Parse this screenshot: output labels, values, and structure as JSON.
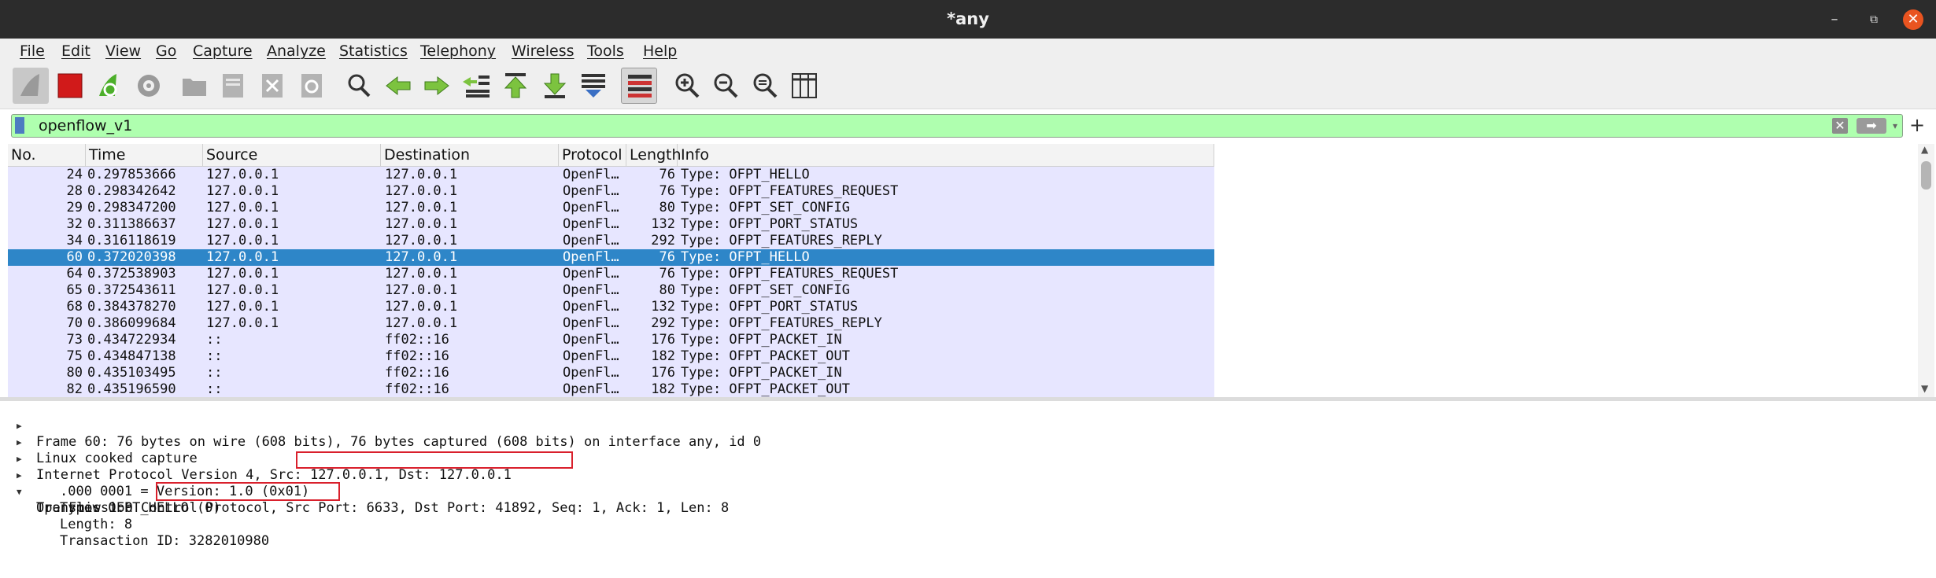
{
  "window": {
    "title": "*any"
  },
  "menu": [
    "File",
    "Edit",
    "View",
    "Go",
    "Capture",
    "Analyze",
    "Statistics",
    "Telephony",
    "Wireless",
    "Tools",
    "Help"
  ],
  "toolbar": {
    "icons": [
      "shark-fin-start-icon",
      "stop-capture-icon",
      "restart-capture-icon",
      "capture-options-icon",
      "open-file-icon",
      "save-file-icon",
      "close-file-icon",
      "reload-file-icon",
      "find-packet-icon",
      "go-back-icon",
      "go-forward-icon",
      "go-to-packet-icon",
      "go-first-icon",
      "go-last-icon",
      "autoscroll-icon",
      "colorize-icon",
      "zoom-in-icon",
      "zoom-out-icon",
      "zoom-normal-icon",
      "resize-columns-icon"
    ]
  },
  "filter": {
    "value": "openflow_v1",
    "plus": "+"
  },
  "packet_list": {
    "columns": [
      "No.",
      "Time",
      "Source",
      "Destination",
      "Protocol",
      "Length",
      "Info"
    ],
    "rows": [
      {
        "no": "24",
        "time": "0.297853666",
        "src": "127.0.0.1",
        "dst": "127.0.0.1",
        "proto": "OpenFl…",
        "len": "76",
        "info": "Type: OFPT_HELLO"
      },
      {
        "no": "28",
        "time": "0.298342642",
        "src": "127.0.0.1",
        "dst": "127.0.0.1",
        "proto": "OpenFl…",
        "len": "76",
        "info": "Type: OFPT_FEATURES_REQUEST"
      },
      {
        "no": "29",
        "time": "0.298347200",
        "src": "127.0.0.1",
        "dst": "127.0.0.1",
        "proto": "OpenFl…",
        "len": "80",
        "info": "Type: OFPT_SET_CONFIG"
      },
      {
        "no": "32",
        "time": "0.311386637",
        "src": "127.0.0.1",
        "dst": "127.0.0.1",
        "proto": "OpenFl…",
        "len": "132",
        "info": "Type: OFPT_PORT_STATUS"
      },
      {
        "no": "34",
        "time": "0.316118619",
        "src": "127.0.0.1",
        "dst": "127.0.0.1",
        "proto": "OpenFl…",
        "len": "292",
        "info": "Type: OFPT_FEATURES_REPLY"
      },
      {
        "no": "60",
        "time": "0.372020398",
        "src": "127.0.0.1",
        "dst": "127.0.0.1",
        "proto": "OpenFl…",
        "len": "76",
        "info": "Type: OFPT_HELLO",
        "selected": true
      },
      {
        "no": "64",
        "time": "0.372538903",
        "src": "127.0.0.1",
        "dst": "127.0.0.1",
        "proto": "OpenFl…",
        "len": "76",
        "info": "Type: OFPT_FEATURES_REQUEST"
      },
      {
        "no": "65",
        "time": "0.372543611",
        "src": "127.0.0.1",
        "dst": "127.0.0.1",
        "proto": "OpenFl…",
        "len": "80",
        "info": "Type: OFPT_SET_CONFIG"
      },
      {
        "no": "68",
        "time": "0.384378270",
        "src": "127.0.0.1",
        "dst": "127.0.0.1",
        "proto": "OpenFl…",
        "len": "132",
        "info": "Type: OFPT_PORT_STATUS"
      },
      {
        "no": "70",
        "time": "0.386099684",
        "src": "127.0.0.1",
        "dst": "127.0.0.1",
        "proto": "OpenFl…",
        "len": "292",
        "info": "Type: OFPT_FEATURES_REPLY"
      },
      {
        "no": "73",
        "time": "0.434722934",
        "src": "::",
        "dst": "ff02::16",
        "proto": "OpenFl…",
        "len": "176",
        "info": "Type: OFPT_PACKET_IN"
      },
      {
        "no": "75",
        "time": "0.434847138",
        "src": "::",
        "dst": "ff02::16",
        "proto": "OpenFl…",
        "len": "182",
        "info": "Type: OFPT_PACKET_OUT"
      },
      {
        "no": "80",
        "time": "0.435103495",
        "src": "::",
        "dst": "ff02::16",
        "proto": "OpenFl…",
        "len": "176",
        "info": "Type: OFPT_PACKET_IN"
      },
      {
        "no": "82",
        "time": "0.435196590",
        "src": "::",
        "dst": "ff02::16",
        "proto": "OpenFl…",
        "len": "182",
        "info": "Type: OFPT_PACKET_OUT"
      }
    ]
  },
  "details": {
    "frame": "Frame 60: 76 bytes on wire (608 bits), 76 bytes captured (608 bits) on interface any, id 0",
    "linux": "Linux cooked capture",
    "ip": "Internet Protocol Version 4, Src: 127.0.0.1, Dst: 127.0.0.1",
    "tcp_prefix": "Transmission Control Protocol, ",
    "tcp_ports": "Src Port: 6633, Dst Port: 41892,",
    "tcp_suffix": " Seq: 1, Ack: 1, Len: 8",
    "openflow": "OpenFlow 1.0",
    "version_prefix": ".000 0001 = ",
    "version": "Version: 1.0 (0x01)",
    "type": "Type: OFPT_HELLO (0)",
    "length": "Length: 8",
    "xid": "Transaction ID: 3282010980"
  },
  "colors": {
    "selected_row": "#2e86c8",
    "row_bg": "#e7e6ff",
    "filter_ok": "#afffaf",
    "highlight_box": "#d9202c"
  }
}
